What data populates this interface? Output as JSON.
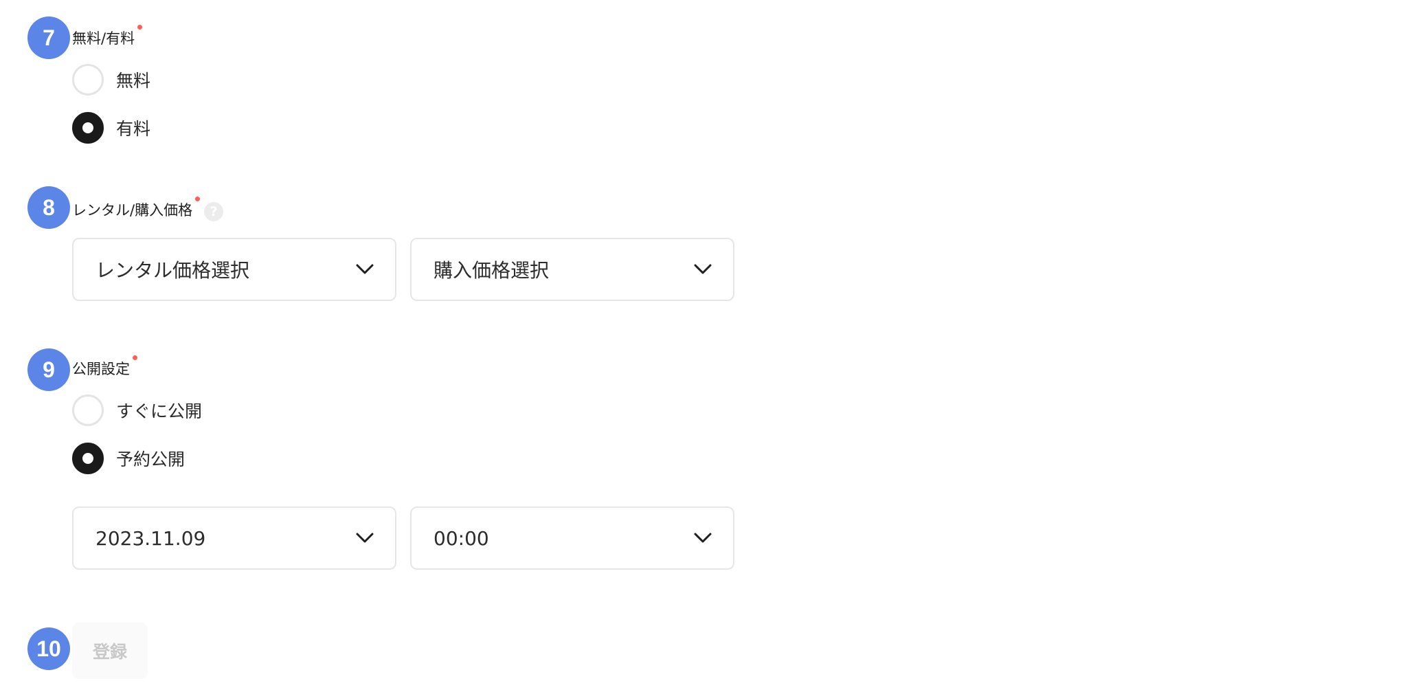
{
  "steps": {
    "s7": {
      "number": "7",
      "label": "無料/有料",
      "options": [
        "無料",
        "有料"
      ],
      "selected": "有料"
    },
    "s8": {
      "number": "8",
      "label": "レンタル/購入価格",
      "help_icon": "?",
      "rental_select": "レンタル価格選択",
      "purchase_select": "購入価格選択"
    },
    "s9": {
      "number": "9",
      "label": "公開設定",
      "options": [
        "すぐに公開",
        "予約公開"
      ],
      "selected": "予約公開",
      "date_value": "2023.11.09",
      "time_value": "00:00"
    },
    "s10": {
      "number": "10",
      "submit_label": "登録"
    }
  },
  "colors": {
    "badge": "#5b85e6",
    "required_dot": "#ff5c5c",
    "radio_selected": "#1a1a1a",
    "border": "#e6e6e6",
    "disabled_text": "#c8c8c8"
  },
  "icons": {
    "dropdown": "chevron-down-icon",
    "help": "help-icon"
  }
}
